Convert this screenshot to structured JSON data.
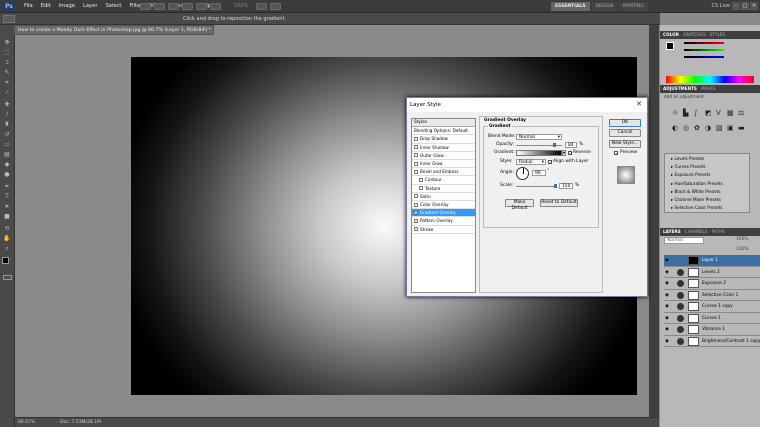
{
  "menubar": {
    "logo": "Ps",
    "items": [
      "File",
      "Edit",
      "Image",
      "Layer",
      "Select",
      "Filter",
      "View",
      "Window",
      "Help"
    ],
    "zoom": "100%",
    "workspaces": [
      "ESSENTIALS",
      "DESIGN",
      "PAINTING"
    ],
    "cs_live": "CS Live"
  },
  "options": {
    "hint": "Click and drag to reposition the gradient."
  },
  "document": {
    "tab_title": "How to create a Moody Dark Effect in Photoshop.jpg @ 66.7% (Layer 1, RGB/8#) *",
    "status_zoom": "66.67%",
    "status_doc": "Doc: 7.03M/28.1M"
  },
  "panels": {
    "color_tabs": [
      "COLOR",
      "SWATCHES",
      "STYLES"
    ],
    "adjust_tabs": [
      "ADJUSTMENTS",
      "MASKS"
    ],
    "adjust_hint": "Add an adjustment",
    "presets": [
      "Levels Presets",
      "Curves Presets",
      "Exposure Presets",
      "Hue/Saturation Presets",
      "Black & White Presets",
      "Channel Mixer Presets",
      "Selective Color Presets"
    ],
    "layer_tabs": [
      "LAYERS",
      "CHANNELS",
      "PATHS"
    ],
    "blend": "Normal",
    "opacity": "100%",
    "fill": "100%",
    "layers": [
      {
        "name": "Layer 1",
        "selected": true
      },
      {
        "name": "Levels 2",
        "selected": false
      },
      {
        "name": "Exposure 2",
        "selected": false
      },
      {
        "name": "Selective Color 1",
        "selected": false
      },
      {
        "name": "Curves 1 copy",
        "selected": false
      },
      {
        "name": "Curves 1",
        "selected": false
      },
      {
        "name": "Vibrance 1",
        "selected": false
      },
      {
        "name": "Brightness/Contrast 1 copy",
        "selected": false
      }
    ]
  },
  "dialog": {
    "title": "Layer Style",
    "styles_header": "Styles",
    "blending_options": "Blending Options: Default",
    "styles": [
      {
        "label": "Drop Shadow",
        "checked": false,
        "indent": false,
        "selected": false
      },
      {
        "label": "Inner Shadow",
        "checked": false,
        "indent": false,
        "selected": false
      },
      {
        "label": "Outer Glow",
        "checked": false,
        "indent": false,
        "selected": false
      },
      {
        "label": "Inner Glow",
        "checked": false,
        "indent": false,
        "selected": false
      },
      {
        "label": "Bevel and Emboss",
        "checked": false,
        "indent": false,
        "selected": false
      },
      {
        "label": "Contour",
        "checked": false,
        "indent": true,
        "selected": false
      },
      {
        "label": "Texture",
        "checked": false,
        "indent": true,
        "selected": false
      },
      {
        "label": "Satin",
        "checked": false,
        "indent": false,
        "selected": false
      },
      {
        "label": "Color Overlay",
        "checked": false,
        "indent": false,
        "selected": false
      },
      {
        "label": "Gradient Overlay",
        "checked": true,
        "indent": false,
        "selected": true
      },
      {
        "label": "Pattern Overlay",
        "checked": false,
        "indent": false,
        "selected": false
      },
      {
        "label": "Stroke",
        "checked": false,
        "indent": false,
        "selected": false
      }
    ],
    "group_title": "Gradient Overlay",
    "subgroup_title": "Gradient",
    "blend_mode_label": "Blend Mode:",
    "blend_mode_value": "Normal",
    "opacity_label": "Opacity:",
    "opacity_value": "84",
    "opacity_fraction": 0.84,
    "percent": "%",
    "gradient_label": "Gradient:",
    "reverse_label": "Reverse",
    "reverse_checked": true,
    "style_label": "Style:",
    "style_value": "Radial",
    "align_label": "Align with Layer",
    "align_checked": true,
    "angle_label": "Angle:",
    "angle_value": "90",
    "degree": "°",
    "scale_label": "Scale:",
    "scale_value": "150",
    "make_default": "Make Default",
    "reset_default": "Reset to Default",
    "ok": "OK",
    "cancel": "Cancel",
    "new_style": "New Style...",
    "preview_label": "Preview",
    "preview_checked": true
  }
}
